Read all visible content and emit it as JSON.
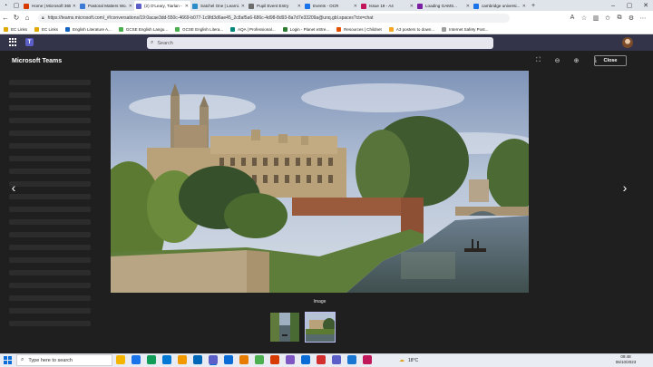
{
  "browser": {
    "tabs": [
      {
        "label": "Home | Microsoft 365",
        "color": "#d83b01",
        "active": false
      },
      {
        "label": "Pastoral Matters Wo...",
        "color": "#3b7bd6",
        "active": false
      },
      {
        "label": "(2) O'Leary, Tiarlan -",
        "color": "#5b5fc7",
        "active": true
      },
      {
        "label": "Satchel One | Learni...",
        "color": "#2a8cc8",
        "active": false
      },
      {
        "label": "Pupil Event Entry",
        "color": "#6c6c6c",
        "active": false
      },
      {
        "label": "Events - OCR",
        "color": "#1a73e8",
        "active": false
      },
      {
        "label": "Issue 19 - A4",
        "color": "#c2185b",
        "active": false
      },
      {
        "label": "Loading GAMS...",
        "color": "#7b1fa2",
        "active": false
      },
      {
        "label": "cambridge universi...",
        "color": "#1a73e8",
        "active": false
      }
    ],
    "url": "https://teams.microsoft.com/_#/conversations/19:0acae3dd-550c-4669-b077-1c9fd3d6ae45_2c8af5a6-686c-4d98-8d93-8a7d7e33209a@unq.gbl.spaces?ctx=chat",
    "bookmarks": [
      {
        "label": "EC Links",
        "color": "#e0a800"
      },
      {
        "label": "EC Links",
        "color": "#e0a800"
      },
      {
        "label": "English Literature A...",
        "color": "#1565c0"
      },
      {
        "label": "GCSE English Langu...",
        "color": "#4caf50"
      },
      {
        "label": "GCSE English Litera...",
        "color": "#4caf50"
      },
      {
        "label": "AQA | Professional...",
        "color": "#00897b"
      },
      {
        "label": "Login - Planet eStre...",
        "color": "#2e7d32"
      },
      {
        "label": "Resources | Childnet",
        "color": "#e65100"
      },
      {
        "label": "A3 posters to down...",
        "color": "#f9a825"
      },
      {
        "label": "Internet Safety Post...",
        "color": "#9e9e9e"
      }
    ]
  },
  "teams": {
    "search_placeholder": "Search"
  },
  "viewer": {
    "title": "Microsoft Teams",
    "close_label": "Close",
    "caption": "Image",
    "prev_icon": "‹",
    "next_icon": "›",
    "thumbnails": [
      "punt-boats-thumbnail",
      "college-thumbnail"
    ],
    "selected_thumbnail": 1
  },
  "taskbar": {
    "search_placeholder": "Type here to search",
    "temperature": "18°C",
    "time": "09:48",
    "date": "06/10/2023",
    "apps": [
      "#f4b400",
      "#1a73e8",
      "#0f9d58",
      "#0078d4",
      "#f29900",
      "#0067b8",
      "#5b5fc7",
      "#0a6cd6",
      "#e67c00",
      "#4caf50",
      "#d83b01",
      "#7e57c2",
      "#0a6cd6",
      "#d32f2f",
      "#5b5fc7",
      "#1976d2",
      "#c2185b"
    ]
  }
}
